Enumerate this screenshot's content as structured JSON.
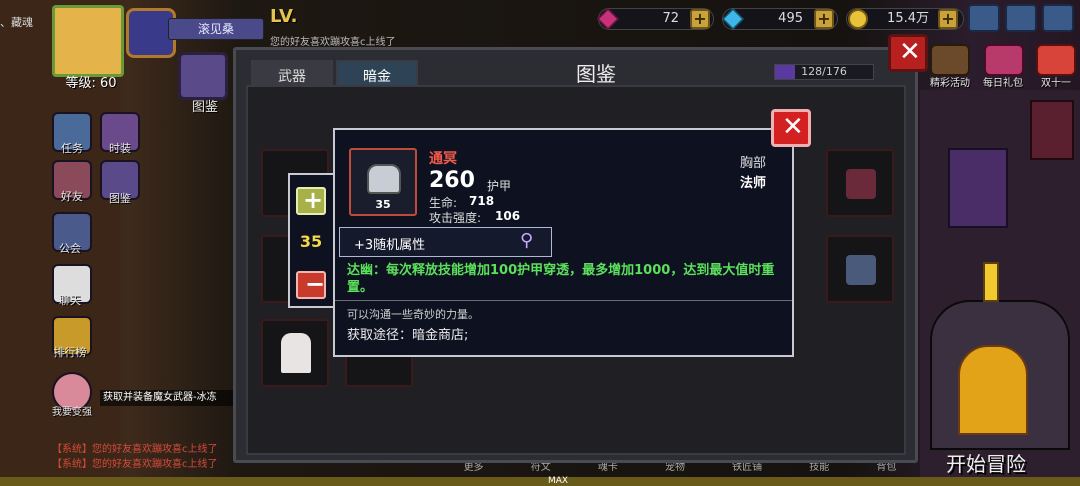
{
  "hud": {
    "player_name_partial": "、藏魂",
    "level_label": "等级: 60",
    "friend_name": "滚见桑",
    "notice_text": "您的好友喜欢蹦攻喜c上线了",
    "gems": "72",
    "diamonds": "495",
    "gold": "15.4万",
    "collection_count": "128/176"
  },
  "left_sidebar": {
    "codex_label": "图鉴",
    "task_label": "任务",
    "fashion_label": "时装",
    "friend_label": "好友",
    "codex2_label": "图鉴",
    "guild_label": "公会",
    "chat_label": "聊天",
    "rank_label": "排行榜",
    "strong_label": "我要变强",
    "quest_text": "获取并装备魔女武器-冰冻",
    "system_msg_1": "【系统】您的好友喜欢蹦攻喜c上线了",
    "system_msg_2": "【系统】您的好友喜欢蹦攻喜c上线了"
  },
  "right_sidebar": {
    "event_label": "精彩活动",
    "daily_gift_label": "每日礼包",
    "double11_label": "双十一",
    "start_label": "开始冒险"
  },
  "bottom_bar": {
    "items": [
      "更多",
      "符文",
      "魂卡",
      "宠物",
      "铁匠铺",
      "技能",
      "背包"
    ],
    "max_label": "MAX"
  },
  "panel": {
    "title": "图鉴",
    "tab_weapon": "武器",
    "tab_dark_gold": "暗金",
    "filter_class": "法师",
    "filter_slot": "胸部"
  },
  "quantity": {
    "value": "35"
  },
  "item": {
    "name": "通冥",
    "level": "35",
    "armor_value": "260",
    "armor_label": "护甲",
    "hp_label": "生命:",
    "hp_value": "718",
    "atk_label": "攻击强度:",
    "atk_value": "106",
    "slot_type": "胸部",
    "class_type": "法师",
    "random_attr": "+3随机属性",
    "skill_text": "达幽：每次释放技能增加100护甲穿透，最多增加1000，达到最大值时重置。",
    "flavor_text": "可以沟通一些奇妙的力量。",
    "source_text": "获取途径：暗金商店;"
  },
  "colors": {
    "accent_red": "#d32020",
    "item_name": "#f25b4a",
    "skill_green": "#5be05b",
    "tab_active": "#2e4456"
  }
}
